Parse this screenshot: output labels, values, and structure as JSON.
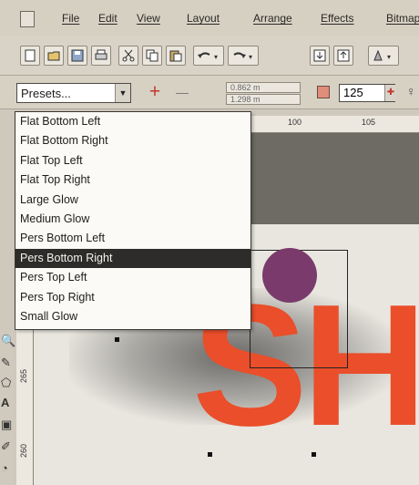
{
  "menu": {
    "items": [
      "File",
      "Edit",
      "View",
      "Layout",
      "Arrange",
      "Effects",
      "Bitmaps"
    ]
  },
  "toolbar1": {
    "icons": [
      "new-icon",
      "open-icon",
      "save-icon",
      "print-icon",
      "cut-icon",
      "copy-icon",
      "paste-icon",
      "undo-icon",
      "redo-icon",
      "import-icon",
      "export-icon",
      "application-launcher-icon"
    ]
  },
  "propertybar": {
    "presets_value": "Presets...",
    "add_preset": "+",
    "remove_preset": "—",
    "coord1": "0.862 m",
    "coord2": "1.298 m",
    "spin_value": "125"
  },
  "presets_dropdown": {
    "items": [
      "Flat Bottom Left",
      "Flat Bottom Right",
      "Flat Top Left",
      "Flat Top Right",
      "Large Glow",
      "Medium Glow",
      "Pers Bottom Left",
      "Pers Bottom Right",
      "Pers Top Left",
      "Pers Top Right",
      "Small Glow"
    ],
    "selected_index": 7
  },
  "ruler": {
    "top_ticks": [
      "100",
      "105"
    ],
    "left_ticks": [
      "265",
      "260"
    ]
  },
  "canvas": {
    "big_text": "SH",
    "colors": {
      "text": "#ea4e2a",
      "circle": "#7a3b6c",
      "shadow": "#333333"
    }
  }
}
